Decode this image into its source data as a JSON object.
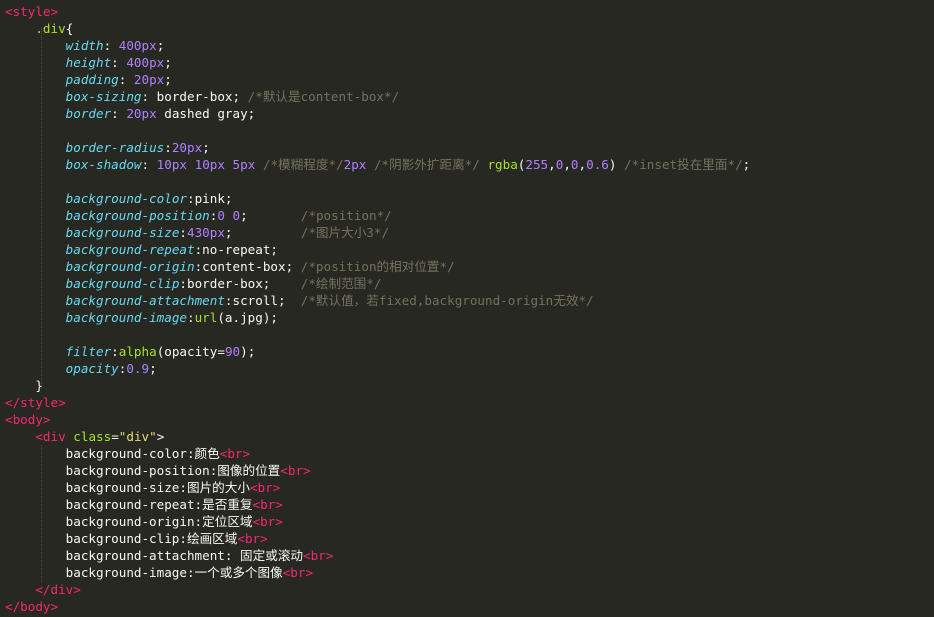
{
  "code": [
    {
      "name": "line-style-open",
      "segments": [
        [
          "tag",
          "<style>"
        ]
      ]
    },
    {
      "name": "line-selector",
      "segments": [
        [
          "pl",
          "    "
        ],
        [
          "sel",
          ".div"
        ],
        [
          "pl",
          "{"
        ]
      ]
    },
    {
      "name": "line-width",
      "segments": [
        [
          "pl",
          "        "
        ],
        [
          "prop",
          "width"
        ],
        [
          "pl",
          ": "
        ],
        [
          "num",
          "400px"
        ],
        [
          "pl",
          ";"
        ]
      ]
    },
    {
      "name": "line-height",
      "segments": [
        [
          "pl",
          "        "
        ],
        [
          "prop",
          "height"
        ],
        [
          "pl",
          ": "
        ],
        [
          "num",
          "400px"
        ],
        [
          "pl",
          ";"
        ]
      ]
    },
    {
      "name": "line-padding",
      "segments": [
        [
          "pl",
          "        "
        ],
        [
          "prop",
          "padding"
        ],
        [
          "pl",
          ": "
        ],
        [
          "num",
          "20px"
        ],
        [
          "pl",
          ";"
        ]
      ]
    },
    {
      "name": "line-box-sizing",
      "segments": [
        [
          "pl",
          "        "
        ],
        [
          "prop",
          "box-sizing"
        ],
        [
          "pl",
          ": border-box; "
        ],
        [
          "cmt",
          "/*默认是content-box*/"
        ]
      ]
    },
    {
      "name": "line-border",
      "segments": [
        [
          "pl",
          "        "
        ],
        [
          "prop",
          "border"
        ],
        [
          "pl",
          ": "
        ],
        [
          "num",
          "20px"
        ],
        [
          "pl",
          " dashed gray;"
        ]
      ]
    },
    {
      "name": "line-blank-1",
      "segments": [
        [
          "pl",
          ""
        ]
      ]
    },
    {
      "name": "line-border-radius",
      "segments": [
        [
          "pl",
          "        "
        ],
        [
          "prop",
          "border-radius"
        ],
        [
          "pl",
          ":"
        ],
        [
          "num",
          "20px"
        ],
        [
          "pl",
          ";"
        ]
      ]
    },
    {
      "name": "line-box-shadow",
      "segments": [
        [
          "pl",
          "        "
        ],
        [
          "prop",
          "box-shadow"
        ],
        [
          "pl",
          ": "
        ],
        [
          "num",
          "10px"
        ],
        [
          "pl",
          " "
        ],
        [
          "num",
          "10px"
        ],
        [
          "pl",
          " "
        ],
        [
          "num",
          "5px"
        ],
        [
          "pl",
          " "
        ],
        [
          "cmt",
          "/*模糊程度*/"
        ],
        [
          "num",
          "2px"
        ],
        [
          "pl",
          " "
        ],
        [
          "cmt",
          "/*阴影外扩距离*/"
        ],
        [
          "pl",
          " "
        ],
        [
          "fn",
          "rgba"
        ],
        [
          "pl",
          "("
        ],
        [
          "num",
          "255"
        ],
        [
          "pl",
          ","
        ],
        [
          "num",
          "0"
        ],
        [
          "pl",
          ","
        ],
        [
          "num",
          "0"
        ],
        [
          "pl",
          ","
        ],
        [
          "num",
          "0.6"
        ],
        [
          "pl",
          ") "
        ],
        [
          "cmt",
          "/*inset投在里面*/"
        ],
        [
          "pl",
          ";"
        ]
      ]
    },
    {
      "name": "line-blank-2",
      "segments": [
        [
          "pl",
          ""
        ]
      ]
    },
    {
      "name": "line-bg-color",
      "segments": [
        [
          "pl",
          "        "
        ],
        [
          "prop",
          "background-color"
        ],
        [
          "pl",
          ":pink;"
        ]
      ]
    },
    {
      "name": "line-bg-position",
      "segments": [
        [
          "pl",
          "        "
        ],
        [
          "prop",
          "background-position"
        ],
        [
          "pl",
          ":"
        ],
        [
          "num",
          "0"
        ],
        [
          "pl",
          " "
        ],
        [
          "num",
          "0"
        ],
        [
          "pl",
          ";       "
        ],
        [
          "cmt",
          "/*position*/"
        ]
      ]
    },
    {
      "name": "line-bg-size",
      "segments": [
        [
          "pl",
          "        "
        ],
        [
          "prop",
          "background-size"
        ],
        [
          "pl",
          ":"
        ],
        [
          "num",
          "430px"
        ],
        [
          "pl",
          ";         "
        ],
        [
          "cmt",
          "/*图片大小3*/"
        ]
      ]
    },
    {
      "name": "line-bg-repeat",
      "segments": [
        [
          "pl",
          "        "
        ],
        [
          "prop",
          "background-repeat"
        ],
        [
          "pl",
          ":no-repeat;"
        ]
      ]
    },
    {
      "name": "line-bg-origin",
      "segments": [
        [
          "pl",
          "        "
        ],
        [
          "prop",
          "background-origin"
        ],
        [
          "pl",
          ":content-box; "
        ],
        [
          "cmt",
          "/*position的相对位置*/"
        ]
      ]
    },
    {
      "name": "line-bg-clip",
      "segments": [
        [
          "pl",
          "        "
        ],
        [
          "prop",
          "background-clip"
        ],
        [
          "pl",
          ":border-box;    "
        ],
        [
          "cmt",
          "/*绘制范围*/"
        ]
      ]
    },
    {
      "name": "line-bg-attachment",
      "segments": [
        [
          "pl",
          "        "
        ],
        [
          "prop",
          "background-attachment"
        ],
        [
          "pl",
          ":scroll;  "
        ],
        [
          "cmt",
          "/*默认值，若fixed,background-origin无效*/"
        ]
      ]
    },
    {
      "name": "line-bg-image",
      "segments": [
        [
          "pl",
          "        "
        ],
        [
          "prop",
          "background-image"
        ],
        [
          "pl",
          ":"
        ],
        [
          "fn",
          "url"
        ],
        [
          "pl",
          "(a.jpg);"
        ]
      ]
    },
    {
      "name": "line-blank-3",
      "segments": [
        [
          "pl",
          ""
        ]
      ]
    },
    {
      "name": "line-filter",
      "segments": [
        [
          "pl",
          "        "
        ],
        [
          "prop",
          "filter"
        ],
        [
          "pl",
          ":"
        ],
        [
          "fn",
          "alpha"
        ],
        [
          "pl",
          "(opacity="
        ],
        [
          "num",
          "90"
        ],
        [
          "pl",
          ");"
        ]
      ]
    },
    {
      "name": "line-opacity",
      "segments": [
        [
          "pl",
          "        "
        ],
        [
          "prop",
          "opacity"
        ],
        [
          "pl",
          ":"
        ],
        [
          "num",
          "0.9"
        ],
        [
          "pl",
          ";"
        ]
      ]
    },
    {
      "name": "line-brace-close",
      "segments": [
        [
          "pl",
          "    }"
        ]
      ]
    },
    {
      "name": "line-style-close",
      "segments": [
        [
          "tag",
          "</style>"
        ]
      ]
    },
    {
      "name": "line-body-open",
      "segments": [
        [
          "tag",
          "<body>"
        ]
      ]
    },
    {
      "name": "line-div-open",
      "segments": [
        [
          "pl",
          "    "
        ],
        [
          "tag",
          "<div"
        ],
        [
          "pl",
          " "
        ],
        [
          "attr",
          "class"
        ],
        [
          "pl",
          "="
        ],
        [
          "str",
          "\"div\""
        ],
        [
          "pl",
          ">"
        ]
      ]
    },
    {
      "name": "line-text-color",
      "segments": [
        [
          "pl",
          "        background-color:颜色"
        ],
        [
          "tag",
          "<br>"
        ]
      ]
    },
    {
      "name": "line-text-position",
      "segments": [
        [
          "pl",
          "        background-position:图像的位置"
        ],
        [
          "tag",
          "<br>"
        ]
      ]
    },
    {
      "name": "line-text-size",
      "segments": [
        [
          "pl",
          "        background-size:图片的大小"
        ],
        [
          "tag",
          "<br>"
        ]
      ]
    },
    {
      "name": "line-text-repeat",
      "segments": [
        [
          "pl",
          "        background-repeat:是否重复"
        ],
        [
          "tag",
          "<br>"
        ]
      ]
    },
    {
      "name": "line-text-origin",
      "segments": [
        [
          "pl",
          "        background-origin:定位区域"
        ],
        [
          "tag",
          "<br>"
        ]
      ]
    },
    {
      "name": "line-text-clip",
      "segments": [
        [
          "pl",
          "        background-clip:绘画区域"
        ],
        [
          "tag",
          "<br>"
        ]
      ]
    },
    {
      "name": "line-text-attachment",
      "segments": [
        [
          "pl",
          "        background-attachment: 固定或滚动"
        ],
        [
          "tag",
          "<br>"
        ]
      ]
    },
    {
      "name": "line-text-image",
      "segments": [
        [
          "pl",
          "        background-image:一个或多个图像"
        ],
        [
          "tag",
          "<br>"
        ]
      ]
    },
    {
      "name": "line-div-close",
      "segments": [
        [
          "pl",
          "    "
        ],
        [
          "tag",
          "</div>"
        ]
      ]
    },
    {
      "name": "line-body-close",
      "segments": [
        [
          "tag",
          "</body>"
        ]
      ]
    }
  ]
}
